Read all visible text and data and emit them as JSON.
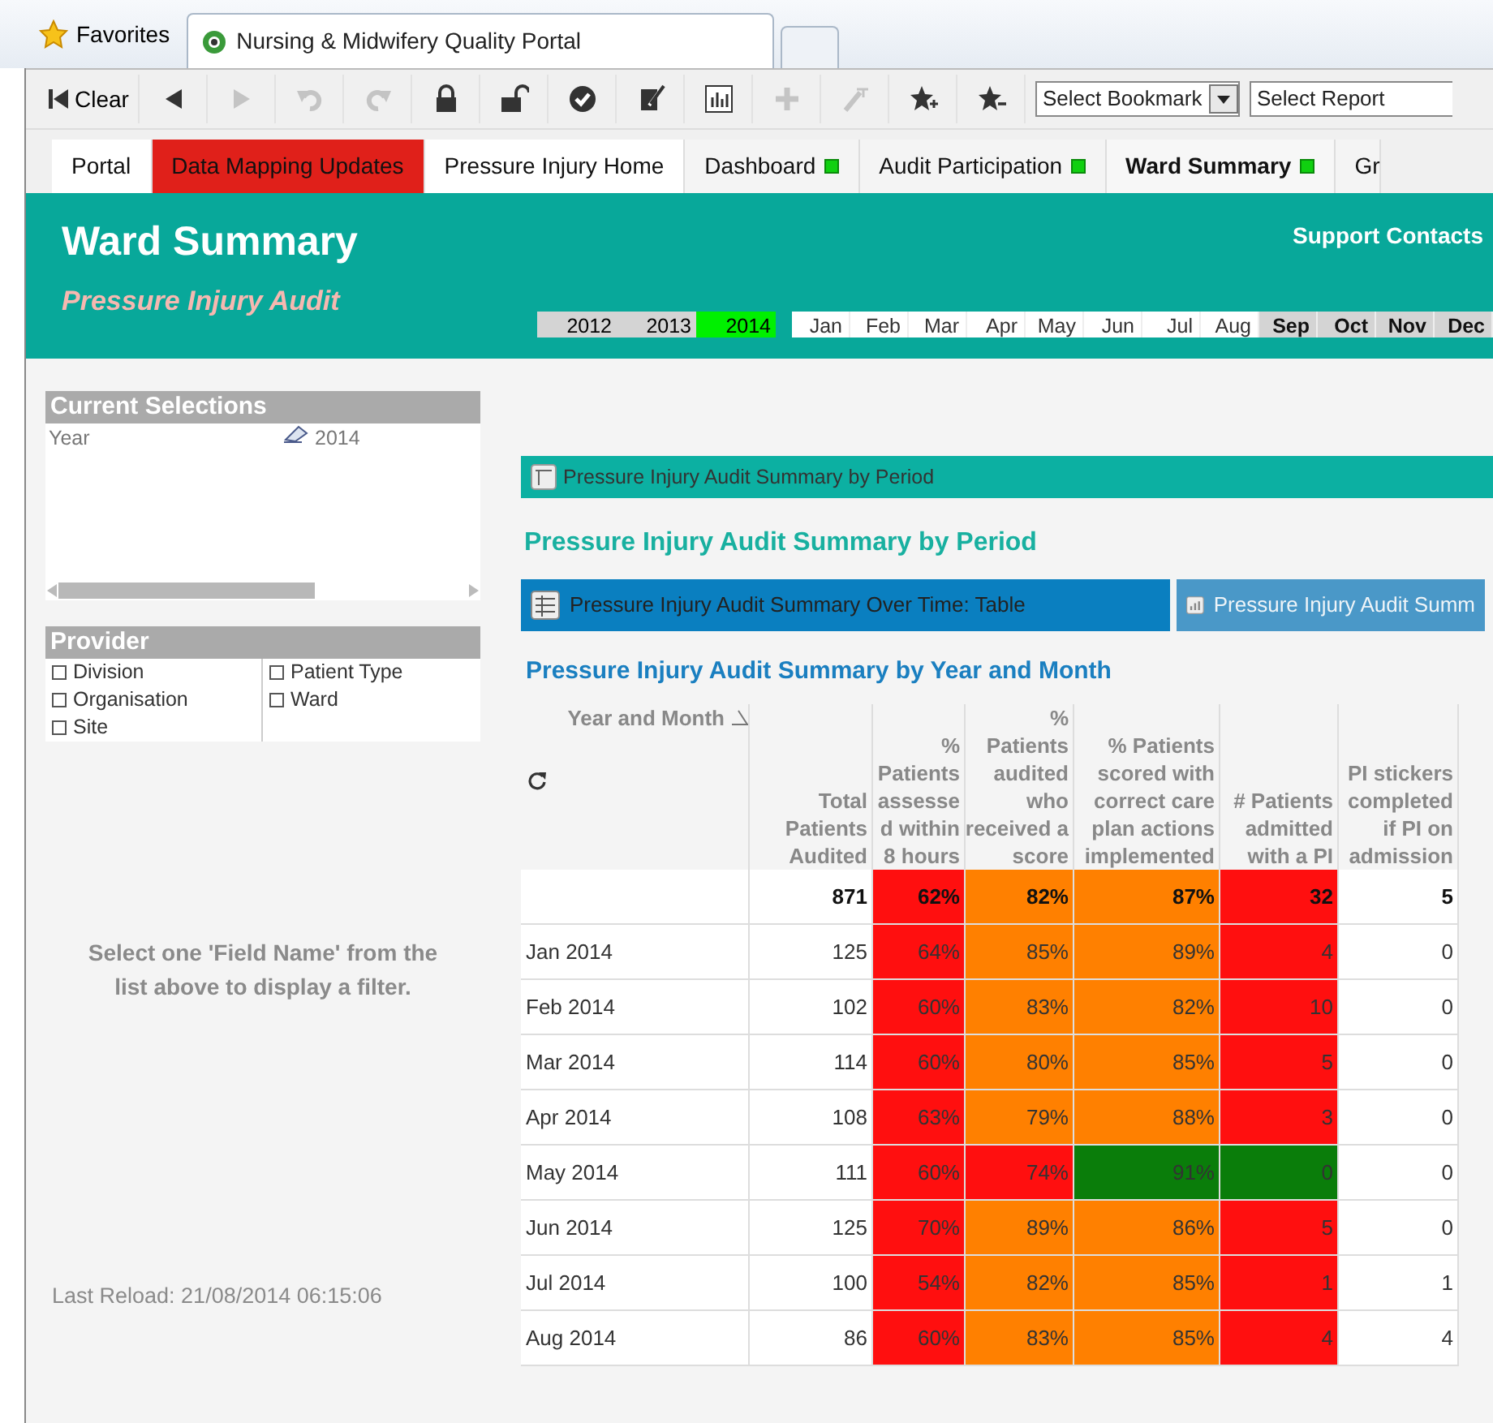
{
  "browser": {
    "favorites": "Favorites",
    "tab_title": "Nursing & Midwifery Quality Portal"
  },
  "toolbar": {
    "clear_label": "Clear",
    "icon_buttons": [
      {
        "disabled": false
      },
      {
        "disabled": true
      },
      {
        "disabled": true
      },
      {
        "disabled": true
      },
      {
        "disabled": false
      },
      {
        "disabled": false
      },
      {
        "disabled": false
      },
      {
        "disabled": false
      },
      {
        "disabled": false
      },
      {
        "disabled": true
      },
      {
        "disabled": true
      },
      {
        "disabled": false
      },
      {
        "disabled": false
      }
    ],
    "bookmark_select": "Select Bookmark",
    "report_select": "Select Report"
  },
  "sheet_tabs": [
    {
      "label": "Portal",
      "selected": false,
      "highlighted": false,
      "status_dot": false
    },
    {
      "label": "Data Mapping Updates",
      "selected": false,
      "highlighted": true,
      "status_dot": false
    },
    {
      "label": "Pressure Injury Home",
      "selected": false,
      "highlighted": false,
      "status_dot": false
    },
    {
      "label": "Dashboard",
      "selected": false,
      "highlighted": false,
      "status_dot": true
    },
    {
      "label": "Audit Participation",
      "selected": false,
      "highlighted": false,
      "status_dot": true
    },
    {
      "label": "Ward Summary",
      "selected": true,
      "highlighted": false,
      "status_dot": true
    },
    {
      "label": "Gr",
      "selected": false,
      "highlighted": false,
      "status_dot": false
    }
  ],
  "header": {
    "title": "Ward Summary",
    "subtitle": "Pressure Injury Audit",
    "support_link": "Support Contacts",
    "years": [
      {
        "label": "2012",
        "selected": false
      },
      {
        "label": "2013",
        "selected": false
      },
      {
        "label": "2014",
        "selected": true
      }
    ],
    "months": [
      {
        "label": "Jan",
        "available": true
      },
      {
        "label": "Feb",
        "available": true
      },
      {
        "label": "Mar",
        "available": true
      },
      {
        "label": "Apr",
        "available": true
      },
      {
        "label": "May",
        "available": true
      },
      {
        "label": "Jun",
        "available": true
      },
      {
        "label": "Jul",
        "available": true
      },
      {
        "label": "Aug",
        "available": true
      },
      {
        "label": "Sep",
        "available": false
      },
      {
        "label": "Oct",
        "available": false
      },
      {
        "label": "Nov",
        "available": false
      },
      {
        "label": "Dec",
        "available": false
      }
    ]
  },
  "current_selections": {
    "title": "Current Selections",
    "items": [
      {
        "field": "Year",
        "value": "2014"
      }
    ]
  },
  "provider": {
    "title": "Provider",
    "columns": [
      [
        {
          "label": "Division",
          "checked": false
        },
        {
          "label": "Organisation",
          "checked": false
        },
        {
          "label": "Site",
          "checked": false
        }
      ],
      [
        {
          "label": "Patient Type",
          "checked": false
        },
        {
          "label": "Ward",
          "checked": false
        }
      ]
    ]
  },
  "filter_hint": "Select one 'Field Name'  from the list above to display a filter.",
  "last_reload": "Last Reload: 21/08/2014 06:15:06",
  "container_caption": "Pressure Injury Audit Summary by Period",
  "section_heading": "Pressure Injury Audit Summary by Period",
  "view_tabs": [
    {
      "label": "Pressure Injury Audit Summary Over Time: Table",
      "selected": true,
      "kind": "table"
    },
    {
      "label": "Pressure Injury Audit Summ",
      "selected": false,
      "kind": "chart"
    }
  ],
  "table_heading": "Pressure Injury Audit Summary by Year and Month",
  "table": {
    "columns": [
      "Year and Month",
      "Total Patients Audited",
      "% Patients assessed within 8 hours",
      "% Patients audited who received a score",
      "% Patients scored with correct care plan actions implemented",
      "# Patients admitted with a PI",
      "PI stickers completed if PI on admission"
    ],
    "rows": [
      {
        "kind": "total",
        "cells": [
          {
            "text": ""
          },
          {
            "text": "871"
          },
          {
            "text": "62%",
            "color": "#ff0f0f"
          },
          {
            "text": "82%",
            "color": "#ff8000"
          },
          {
            "text": "87%",
            "color": "#ff8000"
          },
          {
            "text": "32",
            "color": "#ff0f0f"
          },
          {
            "text": "5"
          }
        ]
      },
      {
        "kind": "month",
        "cells": [
          {
            "text": "Jan 2014"
          },
          {
            "text": "125"
          },
          {
            "text": "64%",
            "color": "#ff0f0f"
          },
          {
            "text": "85%",
            "color": "#ff8000"
          },
          {
            "text": "89%",
            "color": "#ff8000"
          },
          {
            "text": "4",
            "color": "#ff0f0f"
          },
          {
            "text": "0"
          }
        ]
      },
      {
        "kind": "month",
        "cells": [
          {
            "text": "Feb 2014"
          },
          {
            "text": "102"
          },
          {
            "text": "60%",
            "color": "#ff0f0f"
          },
          {
            "text": "83%",
            "color": "#ff8000"
          },
          {
            "text": "82%",
            "color": "#ff8000"
          },
          {
            "text": "10",
            "color": "#ff0f0f"
          },
          {
            "text": "0"
          }
        ]
      },
      {
        "kind": "month",
        "cells": [
          {
            "text": "Mar 2014"
          },
          {
            "text": "114"
          },
          {
            "text": "60%",
            "color": "#ff0f0f"
          },
          {
            "text": "80%",
            "color": "#ff8000"
          },
          {
            "text": "85%",
            "color": "#ff8000"
          },
          {
            "text": "5",
            "color": "#ff0f0f"
          },
          {
            "text": "0"
          }
        ]
      },
      {
        "kind": "month",
        "cells": [
          {
            "text": "Apr 2014"
          },
          {
            "text": "108"
          },
          {
            "text": "63%",
            "color": "#ff0f0f"
          },
          {
            "text": "79%",
            "color": "#ff8000"
          },
          {
            "text": "88%",
            "color": "#ff8000"
          },
          {
            "text": "3",
            "color": "#ff0f0f"
          },
          {
            "text": "0"
          }
        ]
      },
      {
        "kind": "month",
        "cells": [
          {
            "text": "May 2014"
          },
          {
            "text": "111"
          },
          {
            "text": "60%",
            "color": "#ff0f0f"
          },
          {
            "text": "74%",
            "color": "#ff0f0f"
          },
          {
            "text": "91%",
            "color": "#0a7d0a"
          },
          {
            "text": "0",
            "color": "#0a7d0a"
          },
          {
            "text": "0"
          }
        ]
      },
      {
        "kind": "month",
        "cells": [
          {
            "text": "Jun 2014"
          },
          {
            "text": "125"
          },
          {
            "text": "70%",
            "color": "#ff0f0f"
          },
          {
            "text": "89%",
            "color": "#ff8000"
          },
          {
            "text": "86%",
            "color": "#ff8000"
          },
          {
            "text": "5",
            "color": "#ff0f0f"
          },
          {
            "text": "0"
          }
        ]
      },
      {
        "kind": "month",
        "cells": [
          {
            "text": "Jul 2014"
          },
          {
            "text": "100"
          },
          {
            "text": "54%",
            "color": "#ff0f0f"
          },
          {
            "text": "82%",
            "color": "#ff8000"
          },
          {
            "text": "85%",
            "color": "#ff8000"
          },
          {
            "text": "1",
            "color": "#ff0f0f"
          },
          {
            "text": "1"
          }
        ]
      },
      {
        "kind": "month",
        "cells": [
          {
            "text": "Aug 2014"
          },
          {
            "text": "86"
          },
          {
            "text": "60%",
            "color": "#ff0f0f"
          },
          {
            "text": "83%",
            "color": "#ff8000"
          },
          {
            "text": "85%",
            "color": "#ff8000"
          },
          {
            "text": "4",
            "color": "#ff0f0f"
          },
          {
            "text": "4"
          }
        ]
      }
    ]
  }
}
